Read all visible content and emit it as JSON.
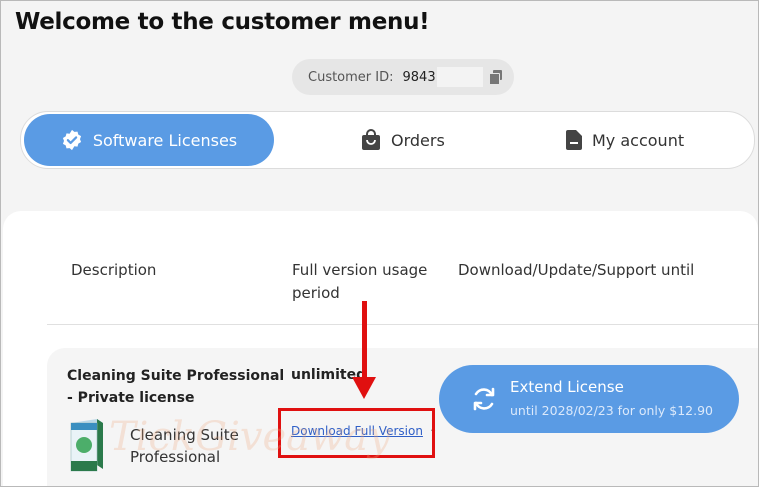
{
  "page": {
    "title": "Welcome to the customer menu!"
  },
  "customer": {
    "label": "Customer ID:",
    "value": "9843"
  },
  "tabs": [
    {
      "label": "Software Licenses",
      "icon": "badge-check-icon"
    },
    {
      "label": "Orders",
      "icon": "shopping-bag-icon"
    },
    {
      "label": "My account",
      "icon": "document-icon"
    }
  ],
  "table": {
    "headers": [
      "Description",
      "Full version usage period",
      "Download/Update/Support until"
    ],
    "rows": [
      {
        "product_name": "Cleaning Suite Professional - Private license",
        "product_label": "Cleaning Suite Professional",
        "usage": "unlimited",
        "download_link": "Download Full Version",
        "extend": {
          "title": "Extend License",
          "subtitle": "until 2028/02/23 for only $12.90"
        }
      }
    ]
  },
  "watermark": "TickGiveaway",
  "colors": {
    "accent": "#5a9be4",
    "highlight": "#e01010",
    "link": "#2f5fc7"
  }
}
